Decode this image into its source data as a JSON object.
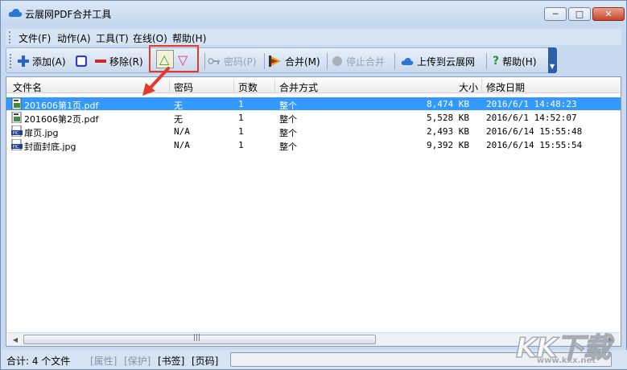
{
  "window": {
    "title": "云展网PDF合并工具",
    "min_label": "─",
    "max_label": "□",
    "close_label": "✕"
  },
  "menu": [
    {
      "label": "文件(F)"
    },
    {
      "label": "动作(A)"
    },
    {
      "label": "工具(T)"
    },
    {
      "label": "在线(O)"
    },
    {
      "label": "帮助(H)"
    }
  ],
  "toolbar": {
    "add": "添加(A)",
    "remove": "移除(R)",
    "up_icon": "△",
    "down_icon": "▽",
    "password": "密码(P)",
    "merge": "合并(M)",
    "stop": "停止合并",
    "upload": "上传到云展网",
    "help": "帮助(H)",
    "help_icon": "?"
  },
  "table": {
    "columns": [
      "文件名",
      "密码",
      "页数",
      "合并方式",
      "大小",
      "修改日期"
    ],
    "rows": [
      {
        "name": "201606第1页.pdf",
        "password": "无",
        "pages": "1",
        "mode": "整个",
        "size": "8,474 KB",
        "date": "2016/6/1 14:48:23",
        "type": "pdf",
        "selected": true
      },
      {
        "name": "201606第2页.pdf",
        "password": "无",
        "pages": "1",
        "mode": "整个",
        "size": "5,528 KB",
        "date": "2016/6/1 14:52:07",
        "type": "pdf",
        "selected": false
      },
      {
        "name": "扉页.jpg",
        "password": "N/A",
        "pages": "1",
        "mode": "整个",
        "size": "2,493 KB",
        "date": "2016/6/14 15:55:48",
        "type": "jpg",
        "selected": false
      },
      {
        "name": "封面封底.jpg",
        "password": "N/A",
        "pages": "1",
        "mode": "整个",
        "size": "9,392 KB",
        "date": "2016/6/14 15:55:54",
        "type": "jpg",
        "selected": false
      }
    ]
  },
  "scrollbar": {
    "left": "◀",
    "right": "▶",
    "grip": "|||"
  },
  "status": {
    "total": "合计: 4 个文件",
    "attr": "[属性]",
    "protect": "[保护]",
    "bookmark": "[书签]",
    "pagecode": "[页码]"
  },
  "watermark": {
    "text": "KK下载",
    "url": "www.kkx.net"
  },
  "colors": {
    "selection": "#3399ff",
    "highlight_box": "#e33a2c",
    "arrow": "#e33a2c"
  }
}
